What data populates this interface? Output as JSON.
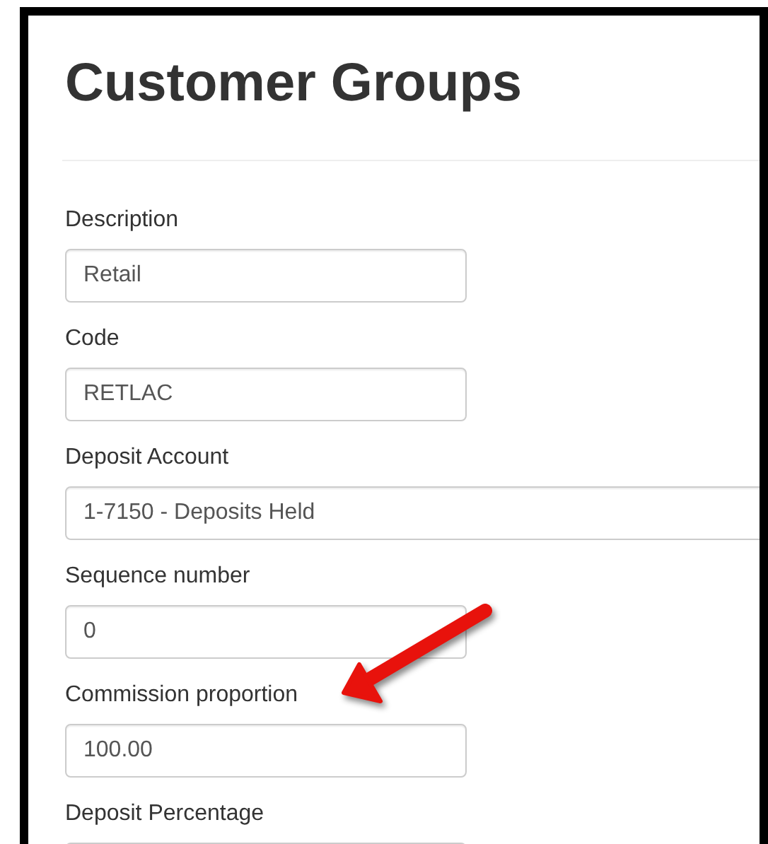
{
  "page": {
    "title": "Customer Groups"
  },
  "fields": [
    {
      "label": "Description",
      "value": "Retail",
      "kind": "text"
    },
    {
      "label": "Code",
      "value": "RETLAC",
      "kind": "text"
    },
    {
      "label": "Deposit Account",
      "value": "1-7150 - Deposits Held",
      "kind": "select"
    },
    {
      "label": "Sequence number",
      "value": "0",
      "kind": "text"
    },
    {
      "label": "Commission proportion",
      "value": "100.00",
      "kind": "text"
    },
    {
      "label": "Deposit Percentage",
      "kind": "text"
    }
  ]
}
